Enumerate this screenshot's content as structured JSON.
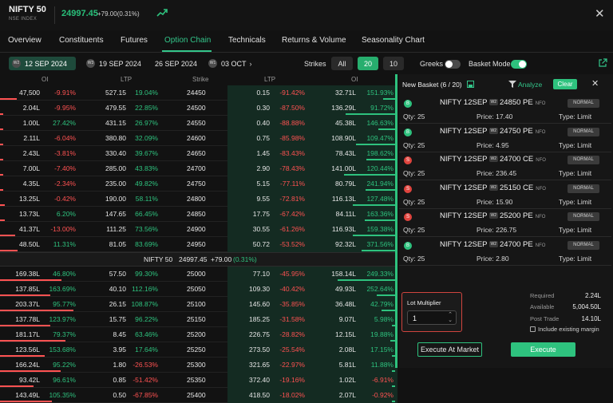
{
  "header": {
    "symbol": "NIFTY 50",
    "exchange": "NSE INDEX",
    "price": "24997.45",
    "change": "+79.00(0.31%)",
    "close_icon": "close-icon",
    "trend_icon": "trend-up-icon"
  },
  "tabs": [
    "Overview",
    "Constituents",
    "Futures",
    "Option Chain",
    "Technicals",
    "Returns & Volume",
    "Seasonality Chart"
  ],
  "expiries": [
    {
      "badge": "W2",
      "date": "12 SEP 2024"
    },
    {
      "badge": "W3",
      "date": "19 SEP 2024"
    },
    {
      "badge": "",
      "date": "26 SEP 2024"
    },
    {
      "badge": "W1",
      "date": "03 OCT"
    }
  ],
  "controls": {
    "strikes_label": "Strikes",
    "strike_options": [
      "All",
      "20",
      "10"
    ],
    "greeks_label": "Greeks",
    "basket_mode_label": "Basket Mode"
  },
  "columns": [
    "OI",
    "LTP",
    "Strike",
    "LTP",
    "OI"
  ],
  "rows_above": [
    {
      "coi": "47,500",
      "coip": "-9.91%",
      "cltp": "527.15",
      "cltpp": "19.04%",
      "strike": "24450",
      "pltp": "0.15",
      "pltpp": "-91.42%",
      "poi": "32.71L",
      "poip": "151.93%"
    },
    {
      "coi": "2.04L",
      "coip": "-9.95%",
      "cltp": "479.55",
      "cltpp": "22.85%",
      "strike": "24500",
      "pltp": "0.30",
      "pltpp": "-87.50%",
      "poi": "136.29L",
      "poip": "91.72%"
    },
    {
      "coi": "1.00L",
      "coip": "27.42%",
      "cltp": "431.15",
      "cltpp": "26.97%",
      "strike": "24550",
      "pltp": "0.40",
      "pltpp": "-88.88%",
      "poi": "45.38L",
      "poip": "146.63%"
    },
    {
      "coi": "2.11L",
      "coip": "-6.04%",
      "cltp": "380.80",
      "cltpp": "32.09%",
      "strike": "24600",
      "pltp": "0.75",
      "pltpp": "-85.98%",
      "poi": "108.90L",
      "poip": "109.47%"
    },
    {
      "coi": "2.43L",
      "coip": "-3.81%",
      "cltp": "330.40",
      "cltpp": "39.67%",
      "strike": "24650",
      "pltp": "1.45",
      "pltpp": "-83.43%",
      "poi": "78.43L",
      "poip": "198.62%"
    },
    {
      "coi": "7.00L",
      "coip": "-7.40%",
      "cltp": "285.00",
      "cltpp": "43.83%",
      "strike": "24700",
      "pltp": "2.90",
      "pltpp": "-78.43%",
      "poi": "141.00L",
      "poip": "120.44%"
    },
    {
      "coi": "4.35L",
      "coip": "-2.34%",
      "cltp": "235.00",
      "cltpp": "49.82%",
      "strike": "24750",
      "pltp": "5.15",
      "pltpp": "-77.11%",
      "poi": "80.79L",
      "poip": "241.94%"
    },
    {
      "coi": "13.25L",
      "coip": "-0.42%",
      "cltp": "190.00",
      "cltpp": "58.11%",
      "strike": "24800",
      "pltp": "9.55",
      "pltpp": "-72.81%",
      "poi": "116.13L",
      "poip": "127.48%"
    },
    {
      "coi": "13.73L",
      "coip": "6.20%",
      "cltp": "147.65",
      "cltpp": "66.45%",
      "strike": "24850",
      "pltp": "17.75",
      "pltpp": "-67.42%",
      "poi": "84.11L",
      "poip": "163.36%"
    },
    {
      "coi": "41.37L",
      "coip": "-13.00%",
      "cltp": "111.25",
      "cltpp": "73.56%",
      "strike": "24900",
      "pltp": "30.55",
      "pltpp": "-61.26%",
      "poi": "116.93L",
      "poip": "159.38%"
    },
    {
      "coi": "48.50L",
      "coip": "11.31%",
      "cltp": "81.05",
      "cltpp": "83.69%",
      "strike": "24950",
      "pltp": "50.72",
      "pltpp": "-53.52%",
      "poi": "92.32L",
      "poip": "371.56%"
    }
  ],
  "spot_row": {
    "name": "NIFTY 50",
    "price": "24997.45",
    "change": "+79.00",
    "pct": "(0.31%)"
  },
  "rows_below": [
    {
      "coi": "169.38L",
      "coip": "46.80%",
      "cltp": "57.50",
      "cltpp": "99.30%",
      "strike": "25000",
      "pltp": "77.10",
      "pltpp": "-45.95%",
      "poi": "158.14L",
      "poip": "249.33%"
    },
    {
      "coi": "137.85L",
      "coip": "163.69%",
      "cltp": "40.10",
      "cltpp": "112.16%",
      "strike": "25050",
      "pltp": "109.30",
      "pltpp": "-40.42%",
      "poi": "49.93L",
      "poip": "252.64%"
    },
    {
      "coi": "203.37L",
      "coip": "95.77%",
      "cltp": "26.15",
      "cltpp": "108.87%",
      "strike": "25100",
      "pltp": "145.60",
      "pltpp": "-35.85%",
      "poi": "36.48L",
      "poip": "42.79%"
    },
    {
      "coi": "137.78L",
      "coip": "123.97%",
      "cltp": "15.75",
      "cltpp": "96.22%",
      "strike": "25150",
      "pltp": "185.25",
      "pltpp": "-31.58%",
      "poi": "9.07L",
      "poip": "5.98%"
    },
    {
      "coi": "181.17L",
      "coip": "79.37%",
      "cltp": "8.45",
      "cltpp": "63.46%",
      "strike": "25200",
      "pltp": "226.75",
      "pltpp": "-28.82%",
      "poi": "12.15L",
      "poip": "19.88%"
    },
    {
      "coi": "123.56L",
      "coip": "153.68%",
      "cltp": "3.95",
      "cltpp": "17.64%",
      "strike": "25250",
      "pltp": "273.50",
      "pltpp": "-25.54%",
      "poi": "2.08L",
      "poip": "17.15%"
    },
    {
      "coi": "166.24L",
      "coip": "95.22%",
      "cltp": "1.80",
      "cltpp": "-26.53%",
      "strike": "25300",
      "pltp": "321.65",
      "pltpp": "-22.97%",
      "poi": "5.81L",
      "poip": "11.88%"
    },
    {
      "coi": "93.42L",
      "coip": "96.61%",
      "cltp": "0.85",
      "cltpp": "-51.42%",
      "strike": "25350",
      "pltp": "372.40",
      "pltpp": "-19.16%",
      "poi": "1.02L",
      "poip": "-6.91%"
    },
    {
      "coi": "143.49L",
      "coip": "105.35%",
      "cltp": "0.50",
      "cltpp": "-67.85%",
      "strike": "25400",
      "pltp": "418.50",
      "pltpp": "-18.02%",
      "poi": "2.07L",
      "poip": "-0.92%"
    }
  ],
  "basket": {
    "title": "New Basket (6 / 20)",
    "analyze": "Analyze",
    "clear": "Clear",
    "orders": [
      {
        "side": "B",
        "name": "NIFTY 12SEP",
        "badge": "W2",
        "leg": "24850 PE",
        "nfo": "NFO",
        "type_badge": "NORMAL",
        "qty": "Qty: 25",
        "price": "Price: 17.40",
        "type": "Type: Limit"
      },
      {
        "side": "B",
        "name": "NIFTY 12SEP",
        "badge": "W2",
        "leg": "24750 PE",
        "nfo": "NFO",
        "type_badge": "NORMAL",
        "qty": "Qty: 25",
        "price": "Price: 4.95",
        "type": "Type: Limit"
      },
      {
        "side": "S",
        "name": "NIFTY 12SEP",
        "badge": "W2",
        "leg": "24700 CE",
        "nfo": "NFO",
        "type_badge": "NORMAL",
        "qty": "Qty: 25",
        "price": "Price: 236.45",
        "type": "Type: Limit"
      },
      {
        "side": "S",
        "name": "NIFTY 12SEP",
        "badge": "W2",
        "leg": "25150 CE",
        "nfo": "NFO",
        "type_badge": "NORMAL",
        "qty": "Qty: 25",
        "price": "Price: 15.90",
        "type": "Type: Limit"
      },
      {
        "side": "S",
        "name": "NIFTY 12SEP",
        "badge": "W2",
        "leg": "25200 PE",
        "nfo": "NFO",
        "type_badge": "NORMAL",
        "qty": "Qty: 25",
        "price": "Price: 226.75",
        "type": "Type: Limit"
      },
      {
        "side": "B",
        "name": "NIFTY 12SEP",
        "badge": "W2",
        "leg": "24700 PE",
        "nfo": "NFO",
        "type_badge": "NORMAL",
        "qty": "Qty: 25",
        "price": "Price: 2.80",
        "type": "Type: Limit"
      }
    ],
    "lot_label": "Lot Multiplier",
    "lot_value": "1",
    "summary": [
      {
        "k": "Required",
        "v": "2.24L"
      },
      {
        "k": "Available",
        "v": "5,004.50L"
      },
      {
        "k": "Post Trade",
        "v": "14.10L"
      }
    ],
    "include_margin": "Include existing margin",
    "execute_market": "Execute At Market",
    "execute": "Execute"
  },
  "colors": {
    "green": "#2ec27e",
    "red": "#ff5252",
    "accent": "#33c58a"
  }
}
